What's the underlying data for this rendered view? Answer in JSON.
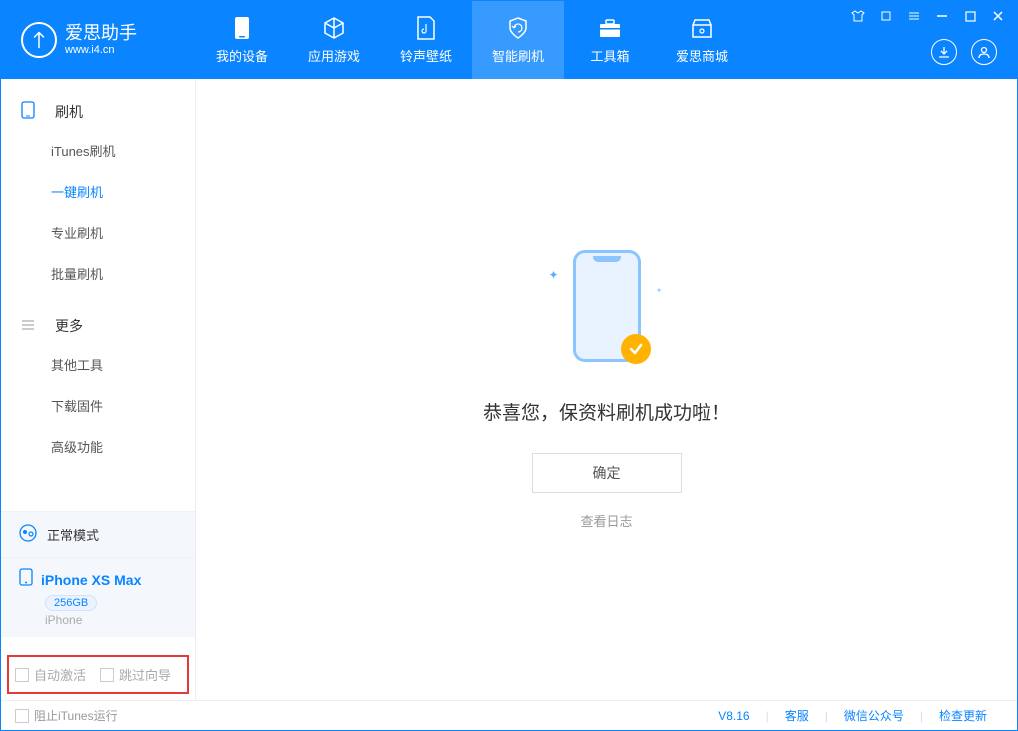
{
  "app": {
    "title": "爱思助手",
    "subtitle": "www.i4.cn"
  },
  "header_tabs": [
    {
      "label": "我的设备"
    },
    {
      "label": "应用游戏"
    },
    {
      "label": "铃声壁纸"
    },
    {
      "label": "智能刷机"
    },
    {
      "label": "工具箱"
    },
    {
      "label": "爱思商城"
    }
  ],
  "sidebar": {
    "section1_title": "刷机",
    "section1_items": [
      {
        "label": "iTunes刷机"
      },
      {
        "label": "一键刷机"
      },
      {
        "label": "专业刷机"
      },
      {
        "label": "批量刷机"
      }
    ],
    "section2_title": "更多",
    "section2_items": [
      {
        "label": "其他工具"
      },
      {
        "label": "下载固件"
      },
      {
        "label": "高级功能"
      }
    ],
    "mode_label": "正常模式",
    "device": {
      "name": "iPhone XS Max",
      "capacity": "256GB",
      "type": "iPhone"
    },
    "auto_activate_label": "自动激活",
    "skip_guide_label": "跳过向导"
  },
  "main": {
    "success_message": "恭喜您，保资料刷机成功啦！",
    "ok_button": "确定",
    "view_log": "查看日志"
  },
  "footer": {
    "block_itunes": "阻止iTunes运行",
    "version": "V8.16",
    "support": "客服",
    "wechat": "微信公众号",
    "check_update": "检查更新"
  }
}
